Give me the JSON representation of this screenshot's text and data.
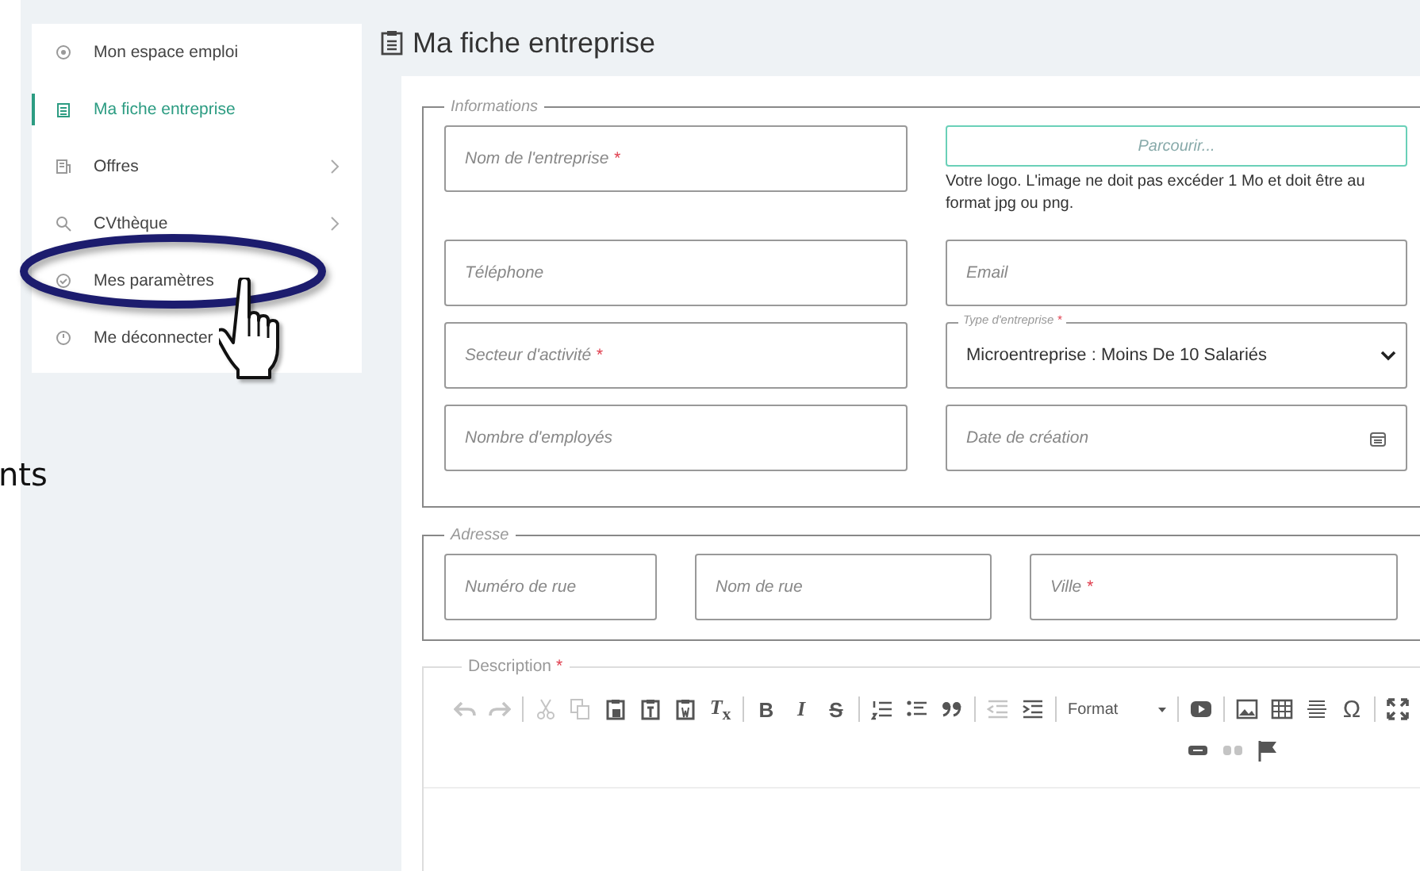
{
  "background_text": "nts",
  "sidebar": {
    "items": [
      {
        "label": "Mon espace emploi",
        "selected": false,
        "has_submenu": false,
        "circled": false,
        "pointed": false
      },
      {
        "label": "Ma fiche entreprise",
        "selected": true,
        "has_submenu": false,
        "circled": false,
        "pointed": false
      },
      {
        "label": "Offres",
        "selected": false,
        "has_submenu": true,
        "circled": false,
        "pointed": false
      },
      {
        "label": "CVthèque",
        "selected": false,
        "has_submenu": true,
        "circled": false,
        "pointed": false
      },
      {
        "label": "Mes paramètres",
        "selected": false,
        "has_submenu": false,
        "circled": true,
        "pointed": true
      },
      {
        "label": "Me déconnecter",
        "selected": false,
        "has_submenu": false,
        "circled": false,
        "pointed": false
      }
    ]
  },
  "page_title": "Ma fiche entreprise",
  "informations": {
    "legend": "Informations",
    "fields": [
      {
        "kind": "input",
        "placeholder": "Nom de l'entreprise",
        "required_mark": "*"
      },
      {
        "kind": "file",
        "button": "Parcourir...",
        "hint": "Votre logo. L'image ne doit pas excéder 1 Mo et doit être au format jpg ou png."
      },
      {
        "kind": "input",
        "placeholder": "Téléphone"
      },
      {
        "kind": "input",
        "placeholder": "Email"
      },
      {
        "kind": "input",
        "placeholder": "Secteur d'activité",
        "required_mark": "*"
      },
      {
        "kind": "select",
        "label": "Type d'entreprise",
        "required_mark": "*",
        "value": "Microentreprise : Moins De 10 Salariés"
      },
      {
        "kind": "input",
        "placeholder": "Nombre d'employés"
      },
      {
        "kind": "date",
        "placeholder": "Date de création"
      }
    ]
  },
  "adresse": {
    "legend": "Adresse",
    "fields": [
      {
        "kind": "input",
        "placeholder": "Numéro de rue"
      },
      {
        "kind": "input",
        "placeholder": "Nom de rue"
      },
      {
        "kind": "input",
        "placeholder": "Ville",
        "required_mark": "*"
      }
    ]
  },
  "description": {
    "legend": "Description",
    "required_mark": "*",
    "toolbar_rows": [
      [
        [
          {
            "kind": "undo",
            "disabled": true
          },
          {
            "kind": "redo",
            "disabled": true
          }
        ],
        [
          {
            "kind": "cut",
            "disabled": true
          },
          {
            "kind": "copy",
            "disabled": true
          },
          {
            "kind": "paste",
            "disabled": false
          },
          {
            "kind": "paste-text",
            "disabled": false
          },
          {
            "kind": "paste-word",
            "disabled": false
          },
          {
            "kind": "remove-format",
            "label": "*T*$_{x}$",
            "disabled": false
          }
        ],
        [
          {
            "kind": "bold",
            "label": "B",
            "disabled": false
          },
          {
            "kind": "italic",
            "label": "I",
            "disabled": false
          },
          {
            "kind": "strike",
            "label": "S",
            "disabled": false
          }
        ],
        [
          {
            "kind": "numbered-list",
            "disabled": false
          },
          {
            "kind": "bullet-list",
            "disabled": false
          },
          {
            "kind": "quote",
            "disabled": false
          }
        ],
        [
          {
            "kind": "outdent",
            "disabled": true
          },
          {
            "kind": "indent",
            "disabled": false
          }
        ],
        [
          {
            "kind": "format",
            "label": "Format",
            "disabled": false
          }
        ],
        [
          {
            "kind": "video",
            "disabled": false
          }
        ],
        [
          {
            "kind": "image",
            "disabled": false
          },
          {
            "kind": "table",
            "disabled": false
          },
          {
            "kind": "rule",
            "disabled": false
          },
          {
            "kind": "special-char",
            "label": "Ω",
            "disabled": false
          }
        ],
        [
          {
            "kind": "maximize",
            "disabled": false
          }
        ]
      ],
      [
        [
          {
            "kind": "link",
            "disabled": false
          },
          {
            "kind": "unlink",
            "disabled": true
          },
          {
            "kind": "anchor",
            "disabled": false
          }
        ]
      ]
    ]
  }
}
